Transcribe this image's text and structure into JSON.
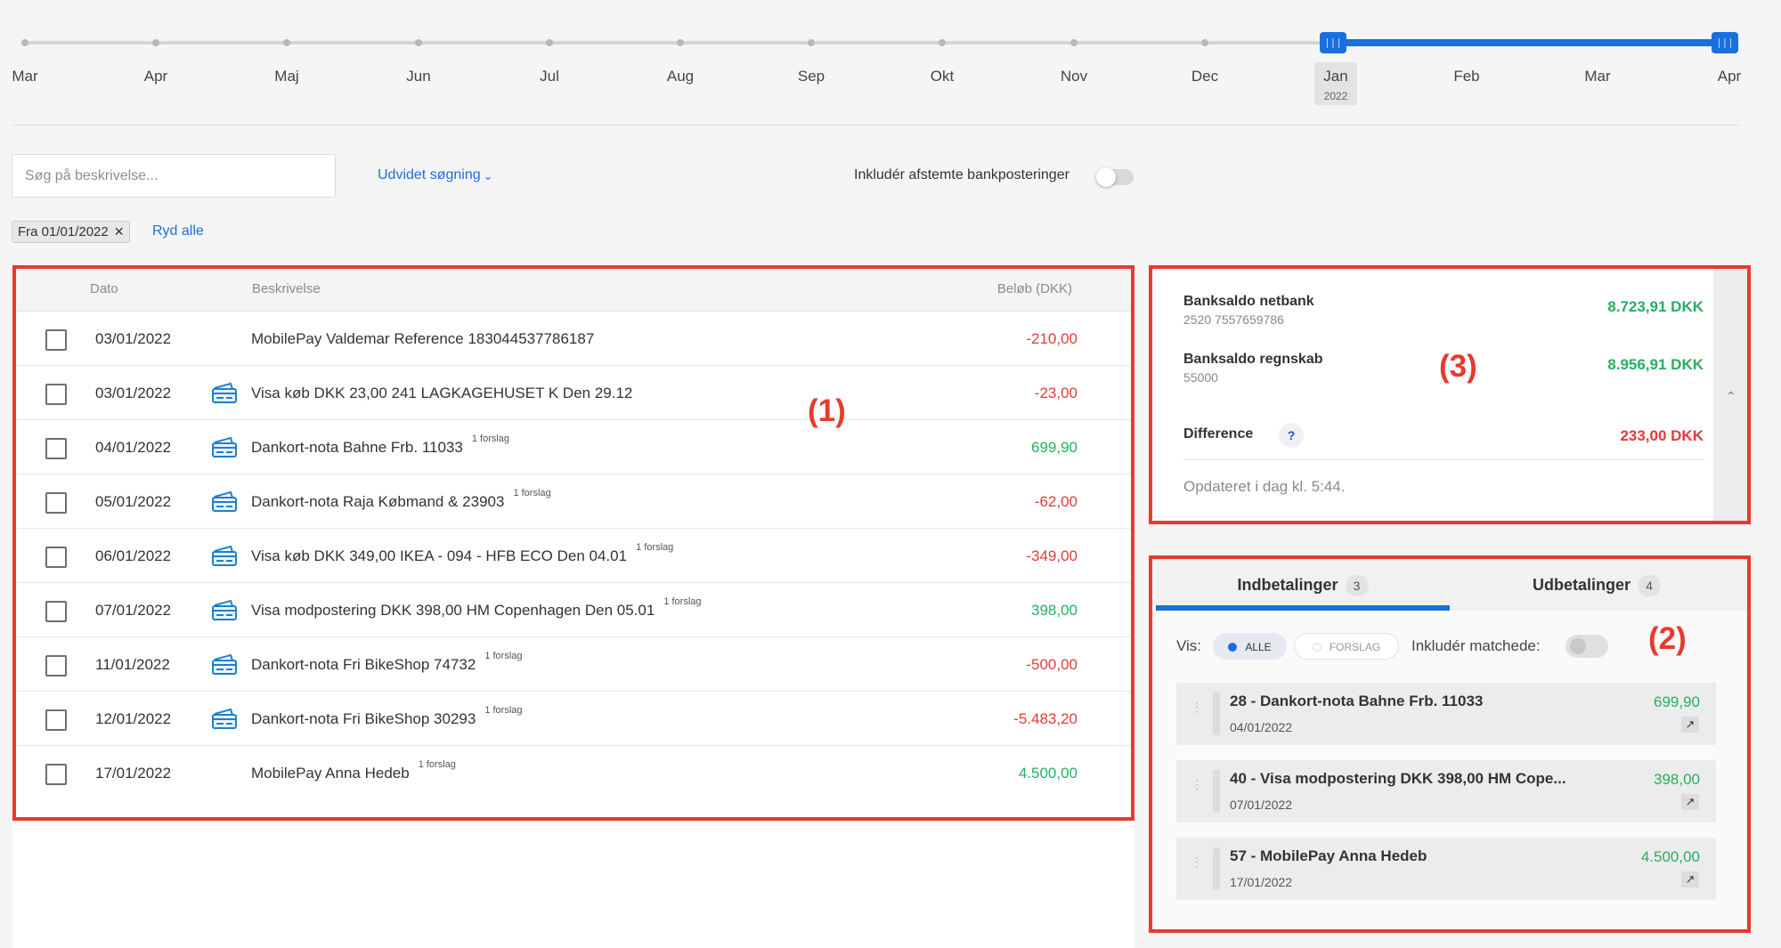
{
  "timeline": {
    "months": [
      "Mar",
      "Apr",
      "Maj",
      "Jun",
      "Jul",
      "Aug",
      "Sep",
      "Okt",
      "Nov",
      "Dec",
      "Jan",
      "Feb",
      "Mar",
      "Apr"
    ],
    "selected_year": "2022",
    "handle_glyph": "|||",
    "range_color": "#1a6fe0"
  },
  "filters": {
    "search_placeholder": "Søg på beskrivelse...",
    "advanced_label": "Udvidet søgning",
    "include_reconciled_label": "Inkludér afstemte bankposteringer",
    "include_reconciled_on": false,
    "active_filter_chip": "Fra 01/01/2022",
    "clear_all_label": "Ryd alle"
  },
  "transactions": {
    "columns": {
      "date": "Dato",
      "description": "Beskrivelse",
      "amount": "Beløb (DKK)"
    },
    "suggestion_label": "1 forslag",
    "rows": [
      {
        "date": "03/01/2022",
        "card_icon": false,
        "description": "MobilePay Valdemar Reference 183044537786187",
        "suggestion": false,
        "amount": "-210,00",
        "sign": "neg"
      },
      {
        "date": "03/01/2022",
        "card_icon": true,
        "description": "Visa køb DKK 23,00 241 LAGKAGEHUSET K Den 29.12",
        "suggestion": false,
        "amount": "-23,00",
        "sign": "neg"
      },
      {
        "date": "04/01/2022",
        "card_icon": true,
        "description": "Dankort-nota Bahne Frb. 11033",
        "suggestion": true,
        "amount": "699,90",
        "sign": "pos"
      },
      {
        "date": "05/01/2022",
        "card_icon": true,
        "description": "Dankort-nota Raja Købmand & 23903",
        "suggestion": true,
        "amount": "-62,00",
        "sign": "neg"
      },
      {
        "date": "06/01/2022",
        "card_icon": true,
        "description": "Visa køb DKK 349,00 IKEA - 094 - HFB ECO Den 04.01",
        "suggestion": true,
        "amount": "-349,00",
        "sign": "neg"
      },
      {
        "date": "07/01/2022",
        "card_icon": true,
        "description": "Visa modpostering DKK 398,00 HM Copenhagen Den 05.01",
        "suggestion": true,
        "amount": "398,00",
        "sign": "pos"
      },
      {
        "date": "11/01/2022",
        "card_icon": true,
        "description": "Dankort-nota Fri BikeShop 74732",
        "suggestion": true,
        "amount": "-500,00",
        "sign": "neg"
      },
      {
        "date": "12/01/2022",
        "card_icon": true,
        "description": "Dankort-nota Fri BikeShop 30293",
        "suggestion": true,
        "amount": "-5.483,20",
        "sign": "neg"
      },
      {
        "date": "17/01/2022",
        "card_icon": false,
        "description": "MobilePay Anna Hedeb",
        "suggestion": true,
        "amount": "4.500,00",
        "sign": "pos"
      }
    ]
  },
  "balance": {
    "netbank": {
      "label": "Banksaldo netbank",
      "account": "2520 7557659786",
      "value": "8.723,91 DKK"
    },
    "regnskab": {
      "label": "Banksaldo regnskab",
      "account": "55000",
      "value": "8.956,91 DKK"
    },
    "difference": {
      "label": "Difference",
      "help": "?",
      "value": "233,00 DKK"
    },
    "updated": "Opdateret i dag kl. 5:44.",
    "collapse_glyph": "⌃"
  },
  "matching": {
    "tabs": [
      {
        "label": "Indbetalinger",
        "count": "3",
        "active": true
      },
      {
        "label": "Udbetalinger",
        "count": "4",
        "active": false
      }
    ],
    "show_label": "Vis:",
    "filters": [
      {
        "label": "ALLE",
        "on": true
      },
      {
        "label": "FORSLAG",
        "on": false
      }
    ],
    "include_matched_label": "Inkludér matchede:",
    "include_matched_on": false,
    "items": [
      {
        "title": "28  -  Dankort-nota Bahne Frb. 11033",
        "date": "04/01/2022",
        "amount": "699,90"
      },
      {
        "title": "40  -  Visa modpostering DKK 398,00 HM Cope...",
        "date": "07/01/2022",
        "amount": "398,00"
      },
      {
        "title": "57  -  MobilePay Anna Hedeb",
        "date": "17/01/2022",
        "amount": "4.500,00"
      }
    ],
    "link_glyph": "↗",
    "drag_glyph": "⋮"
  },
  "annotations": [
    "(1)",
    "(2)",
    "(3)"
  ],
  "colors": {
    "accent": "#1a6fe0",
    "negative": "#e03b3b",
    "positive": "#27ae60",
    "annotation": "#e83a2c"
  }
}
